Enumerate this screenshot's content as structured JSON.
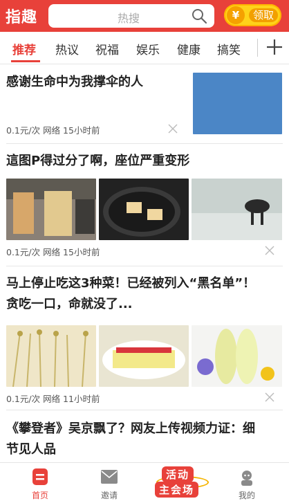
{
  "header": {
    "logo": "指趣",
    "search_placeholder": "热搜",
    "coin_symbol": "¥",
    "coin_label": "领取"
  },
  "tabs": [
    "推荐",
    "热议",
    "祝福",
    "娱乐",
    "健康",
    "搞笑"
  ],
  "feed": [
    {
      "title": "感谢生命中为我撑伞的人",
      "meta": "0.1元/次 网络 15小时前"
    },
    {
      "title": "這图P得过分了啊，座位严重变形",
      "meta": "0.1元/次 网络 15小时前"
    },
    {
      "title_line1": "马上停止吃这3种菜！已经被列入“黑名单”！",
      "title_line2": "贪吃一口，命就没了...",
      "meta": "0.1元/次 网络 11小时前"
    },
    {
      "title_line1": "《攀登者》吴京飘了？网友上传视频力证：细",
      "title_line2": "节见人品"
    }
  ],
  "bottom_nav": {
    "home": "首页",
    "invite": "邀请",
    "activity_top": "活动",
    "activity_bottom": "主会场",
    "mine": "我的"
  },
  "colors": {
    "accent": "#e8413a",
    "gold": "#ffd31a"
  }
}
